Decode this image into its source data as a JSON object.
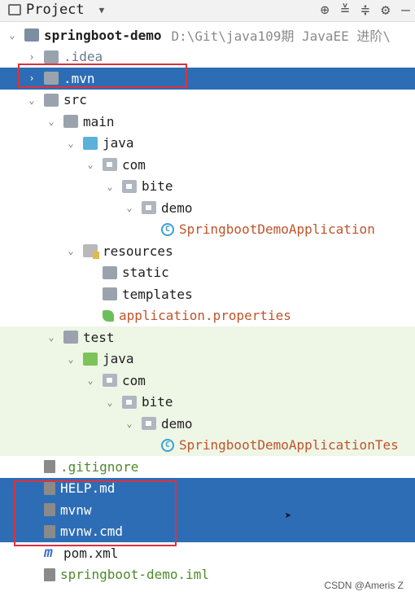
{
  "panel": {
    "title": "Project",
    "caret": "▼",
    "icons": [
      "crosshair-icon",
      "expand-all-icon",
      "collapse-all-icon",
      "gear-icon",
      "minimize-icon"
    ]
  },
  "tree": [
    {
      "label": "springboot-demo",
      "path": "D:\\Git\\java109期 JavaEE 进阶\\",
      "level": 0,
      "chev": "⌄",
      "icon": "module-folder-icon",
      "bold": true
    },
    {
      "label": ".idea",
      "level": 1,
      "chev": "›",
      "icon": "folder-icon"
    },
    {
      "label": ".mvn",
      "level": 1,
      "chev": "›",
      "icon": "folder-icon",
      "selected": true
    },
    {
      "label": "src",
      "level": 1,
      "chev": "⌄",
      "icon": "folder-icon"
    },
    {
      "label": "main",
      "level": 2,
      "chev": "⌄",
      "icon": "folder-icon"
    },
    {
      "label": "java",
      "level": 3,
      "chev": "⌄",
      "icon": "source-root-icon"
    },
    {
      "label": "com",
      "level": 4,
      "chev": "⌄",
      "icon": "package-icon"
    },
    {
      "label": "bite",
      "level": 5,
      "chev": "⌄",
      "icon": "package-icon"
    },
    {
      "label": "demo",
      "level": 6,
      "chev": "⌄",
      "icon": "package-icon"
    },
    {
      "label": "SpringbootDemoApplication",
      "level": 7,
      "chev": "",
      "icon": "spring-class-icon"
    },
    {
      "label": "resources",
      "level": 3,
      "chev": "⌄",
      "icon": "resources-folder-icon"
    },
    {
      "label": "static",
      "level": 4,
      "chev": "",
      "icon": "folder-icon"
    },
    {
      "label": "templates",
      "level": 4,
      "chev": "",
      "icon": "folder-icon"
    },
    {
      "label": "application.properties",
      "level": 4,
      "chev": "",
      "icon": "spring-properties-icon"
    },
    {
      "label": "test",
      "level": 2,
      "chev": "⌄",
      "icon": "folder-icon"
    },
    {
      "label": "java",
      "level": 3,
      "chev": "⌄",
      "icon": "test-root-icon"
    },
    {
      "label": "com",
      "level": 4,
      "chev": "⌄",
      "icon": "package-icon"
    },
    {
      "label": "bite",
      "level": 5,
      "chev": "⌄",
      "icon": "package-icon"
    },
    {
      "label": "demo",
      "level": 6,
      "chev": "⌄",
      "icon": "package-icon"
    },
    {
      "label": "SpringbootDemoApplicationTes",
      "level": 7,
      "chev": "",
      "icon": "spring-class-icon"
    },
    {
      "label": ".gitignore",
      "level": 1,
      "chev": "",
      "icon": "ignored-file-icon"
    },
    {
      "label": "HELP.md",
      "level": 1,
      "chev": "",
      "icon": "markdown-file-icon",
      "selected": true
    },
    {
      "label": "mvnw",
      "level": 1,
      "chev": "",
      "icon": "shell-script-icon",
      "selected": true
    },
    {
      "label": "mvnw.cmd",
      "level": 1,
      "chev": "",
      "icon": "text-file-icon",
      "selected": true
    },
    {
      "label": "pom.xml",
      "level": 1,
      "chev": "",
      "icon": "maven-icon"
    },
    {
      "label": "springboot-demo.iml",
      "level": 1,
      "chev": "",
      "icon": "module-file-icon"
    }
  ],
  "watermark": "CSDN @Ameris Z",
  "colors": {
    "selection": "#2d6db5",
    "annotation_box": "#d9333f",
    "test_bg": "#eef6e6"
  }
}
